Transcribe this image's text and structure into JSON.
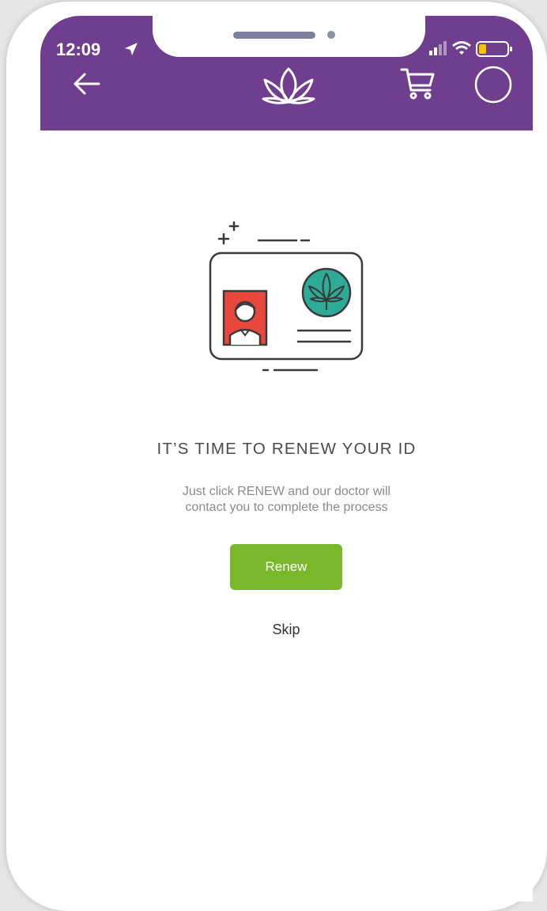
{
  "status_bar": {
    "time": "12:09",
    "location_icon": "location-arrow-icon",
    "signal_icon": "cellular-signal-icon",
    "wifi_icon": "wifi-icon",
    "battery_icon": "battery-low-icon"
  },
  "nav_bar": {
    "back_icon": "back-arrow-icon",
    "logo_icon": "cannabis-leaf-logo-icon",
    "cart_icon": "shopping-cart-icon",
    "profile_icon": "profile-circle-icon"
  },
  "content": {
    "illustration_icon": "id-card-illustration-icon",
    "title": "IT’S TIME TO RENEW YOUR ID",
    "subtitle_line1": "Just click RENEW and our doctor will",
    "subtitle_line2": "contact you to complete the process",
    "renew_label": "Renew",
    "skip_label": "Skip"
  },
  "colors": {
    "header_purple": "#6f3e8f",
    "renew_green": "#78b82a",
    "badge_teal": "#2eab96",
    "photo_red": "#e8473b",
    "battery_yellow": "#f5c400",
    "title_text": "#4a4a4a",
    "subtitle_text": "#8a8a8a"
  }
}
